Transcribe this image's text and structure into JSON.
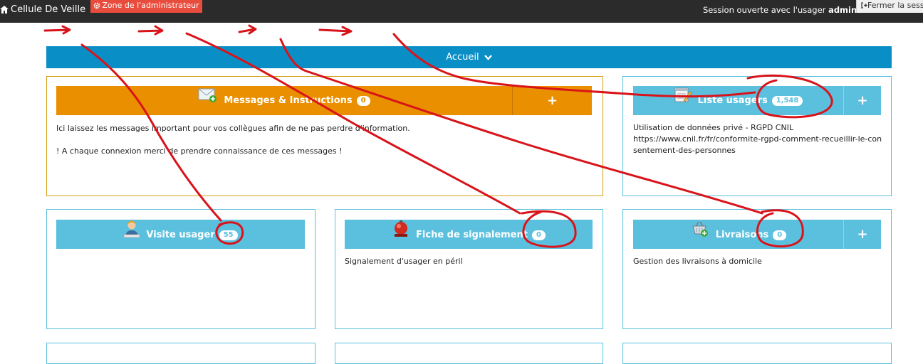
{
  "navbar": {
    "brand": "Cellule De Veille",
    "admin_zone": "Zone de l'administrateur",
    "session_prefix": "Session ouverte avec l'usager",
    "session_user": "admin",
    "logout": "Fermer la session"
  },
  "accueil": {
    "label": "Accueil"
  },
  "panels": {
    "messages": {
      "title": "Messages & Instructions",
      "badge": "0",
      "plus": "+",
      "line1": "Ici laissez les messages important pour vos collègues afin de ne pas perdre d'information.",
      "line2": "! A chaque connexion merci de prendre connaissance de ces messages !"
    },
    "liste_usagers": {
      "title": "Liste usagers",
      "badge": "1,548",
      "plus": "+",
      "line1": "Utilisation de données privé - RGPD CNIL",
      "line2": "https://www.cnil.fr/fr/conformite-rgpd-comment-recueillir-le-consentement-des-personnes"
    },
    "visite": {
      "title": "Visite usager",
      "badge": "55"
    },
    "signalement": {
      "title": "Fiche de signalement",
      "badge": "0",
      "line1": "Signalement d'usager en péril"
    },
    "livraisons": {
      "title": "Livraisons",
      "badge": "0",
      "plus": "+",
      "line1": "Gestion des livraisons à domicile"
    }
  },
  "colors": {
    "navbar": "#2b2b2b",
    "admin_button": "#e84c3d",
    "accueil": "#0a8ec6",
    "panel_header": "#5bc0de",
    "panel_header_orange": "#ea8f00",
    "annotation": "#d8141a"
  },
  "icons": [
    "home-icon",
    "gear-icon",
    "logout-icon",
    "chevron-down-icon",
    "envelope-add-icon",
    "ledger-icon",
    "visitor-icon",
    "alarm-bell-icon",
    "basket-add-icon"
  ]
}
